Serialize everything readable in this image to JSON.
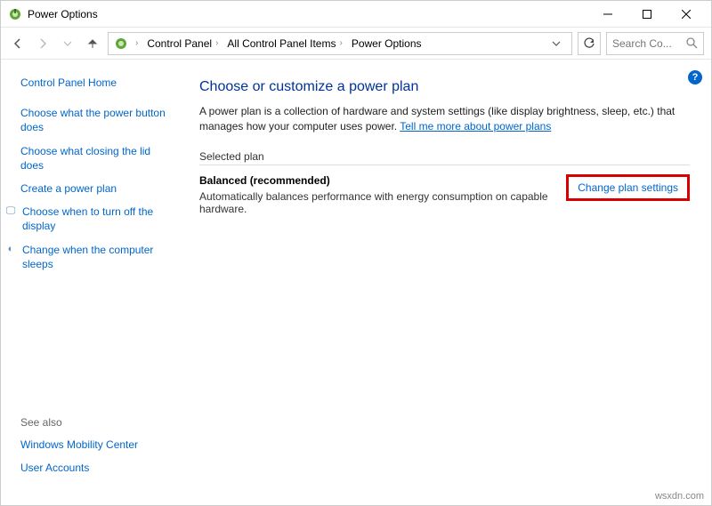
{
  "window": {
    "title": "Power Options"
  },
  "breadcrumbs": {
    "items": [
      "Control Panel",
      "All Control Panel Items",
      "Power Options"
    ]
  },
  "search": {
    "placeholder": "Search Co..."
  },
  "sidebar": {
    "home": "Control Panel Home",
    "links": [
      {
        "label": "Choose what the power button does"
      },
      {
        "label": "Choose what closing the lid does"
      },
      {
        "label": "Create a power plan"
      },
      {
        "label": "Choose when to turn off the display",
        "icon": "🖵"
      },
      {
        "label": "Change when the computer sleeps",
        "icon": "◐"
      }
    ],
    "see_also_label": "See also",
    "see_also": [
      {
        "label": "Windows Mobility Center"
      },
      {
        "label": "User Accounts"
      }
    ]
  },
  "main": {
    "heading": "Choose or customize a power plan",
    "description_prefix": "A power plan is a collection of hardware and system settings (like display brightness, sleep, etc.) that manages how your computer uses power. ",
    "description_link": "Tell me more about power plans",
    "section_label": "Selected plan",
    "plan": {
      "name": "Balanced (recommended)",
      "desc": "Automatically balances performance with energy consumption on capable hardware.",
      "change_link": "Change plan settings"
    }
  },
  "watermark": "wsxdn.com"
}
